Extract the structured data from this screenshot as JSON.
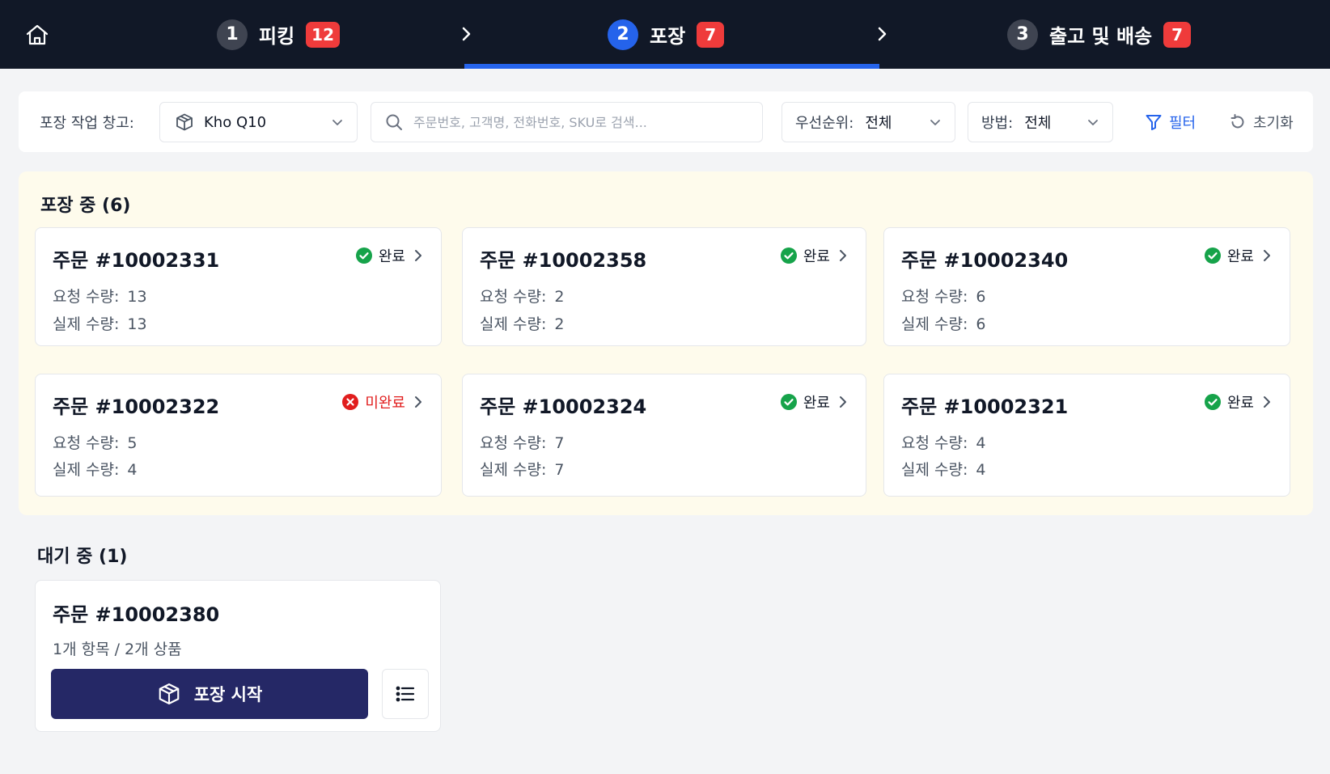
{
  "steps": [
    {
      "number": "1",
      "label": "피킹",
      "badge": "12",
      "active": false
    },
    {
      "number": "2",
      "label": "포장",
      "badge": "7",
      "active": true
    },
    {
      "number": "3",
      "label": "출고 및 배송",
      "badge": "7",
      "active": false
    }
  ],
  "icons": {
    "home": "home-icon",
    "chevron": "chevron-right-icon",
    "box": "box-icon",
    "search": "search-icon",
    "dropdown": "chevron-down-icon",
    "filter": "funnel-icon",
    "reset": "rotate-ccw-icon",
    "complete": "check-circle-icon",
    "incomplete": "x-circle-icon",
    "list": "list-icon"
  },
  "colors": {
    "topbar": "#111827",
    "active_step": "#2563eb",
    "badge": "#ef3b3b",
    "complete": "#16a34a",
    "incomplete": "#e11d1d",
    "packing_bg": "#fefbec",
    "primary_button": "#252866"
  },
  "filter": {
    "warehouse_label": "포장 작업 창고:",
    "warehouse_value": "Kho Q10",
    "search_placeholder": "주문번호, 고객명, 전화번호, SKU로 검색...",
    "search_value": "",
    "priority_label": "우선순위:",
    "priority_value": "전체",
    "method_label": "방법:",
    "method_value": "전체",
    "filter_button": "필터",
    "reset_button": "초기화"
  },
  "packing": {
    "title": "포장 중 (6)",
    "requested_label": "요청 수량:",
    "actual_label": "실제 수량:",
    "orders": [
      {
        "title": "주문 #10002331",
        "status": "완료",
        "complete": true,
        "requested": "13",
        "actual": "13"
      },
      {
        "title": "주문 #10002358",
        "status": "완료",
        "complete": true,
        "requested": "2",
        "actual": "2"
      },
      {
        "title": "주문 #10002340",
        "status": "완료",
        "complete": true,
        "requested": "6",
        "actual": "6"
      },
      {
        "title": "주문 #10002322",
        "status": "미완료",
        "complete": false,
        "requested": "5",
        "actual": "4"
      },
      {
        "title": "주문 #10002324",
        "status": "완료",
        "complete": true,
        "requested": "7",
        "actual": "7"
      },
      {
        "title": "주문 #10002321",
        "status": "완료",
        "complete": true,
        "requested": "4",
        "actual": "4"
      }
    ]
  },
  "waiting": {
    "title": "대기 중 (1)",
    "order": {
      "title": "주문 #10002380",
      "summary": "1개 항목 / 2개 상품",
      "start_button": "포장 시작"
    }
  }
}
